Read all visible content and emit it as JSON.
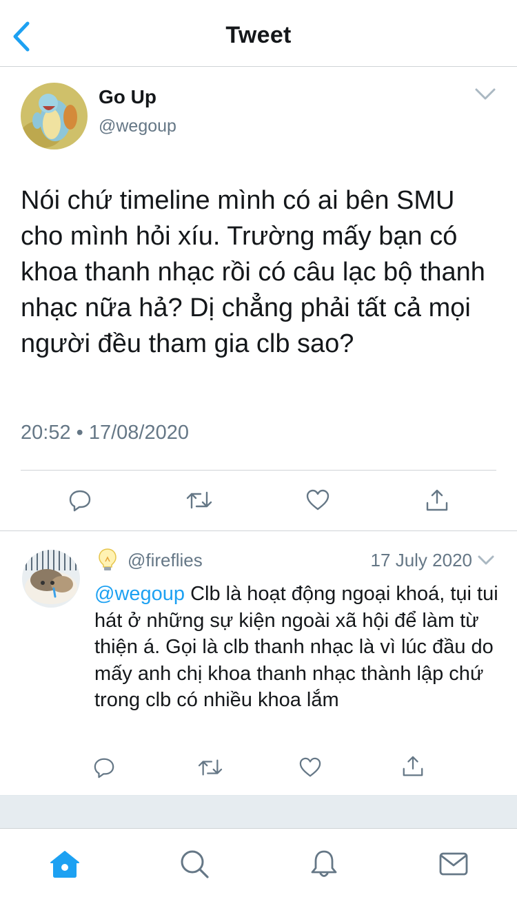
{
  "header": {
    "title": "Tweet",
    "back_icon": "chevron-left-icon"
  },
  "main_tweet": {
    "author_name": "Go Up",
    "author_handle": "@wegoup",
    "text": "Nói chứ timeline mình có ai bên SMU cho mình hỏi xíu. Trường mấy bạn có khoa thanh nhạc rồi có câu lạc bộ thanh nhạc nữa hả? Dị chẳng phải tất cả mọi người đều tham gia clb sao?",
    "timestamp": "20:52 • 17/08/2020",
    "actions": [
      "reply-icon",
      "retweet-icon",
      "like-icon",
      "share-icon"
    ]
  },
  "reply_tweet": {
    "emoji": "light-bulb-icon",
    "author_handle": "@fireflies",
    "date": "17 July 2020",
    "mention": "@wegoup",
    "text": " Clb là hoạt động ngoại khoá, tụi tui hát ở những sự kiện ngoài xã hội để làm từ thiện á. Gọi là clb thanh nhạc là vì lúc đầu do mấy anh chị khoa thanh nhạc thành lập chứ trong clb có nhiều khoa lắm",
    "actions": [
      "reply-icon",
      "retweet-icon",
      "like-icon",
      "share-icon"
    ]
  },
  "tabbar": {
    "tabs": [
      "home-icon",
      "search-icon",
      "notifications-icon",
      "messages-icon"
    ],
    "active_tab": "home-icon"
  },
  "colors": {
    "accent": "#1da1f2",
    "text_primary": "#14171a",
    "text_secondary": "#657786",
    "divider": "#cfd3d6",
    "band": "#e6ecf0"
  }
}
